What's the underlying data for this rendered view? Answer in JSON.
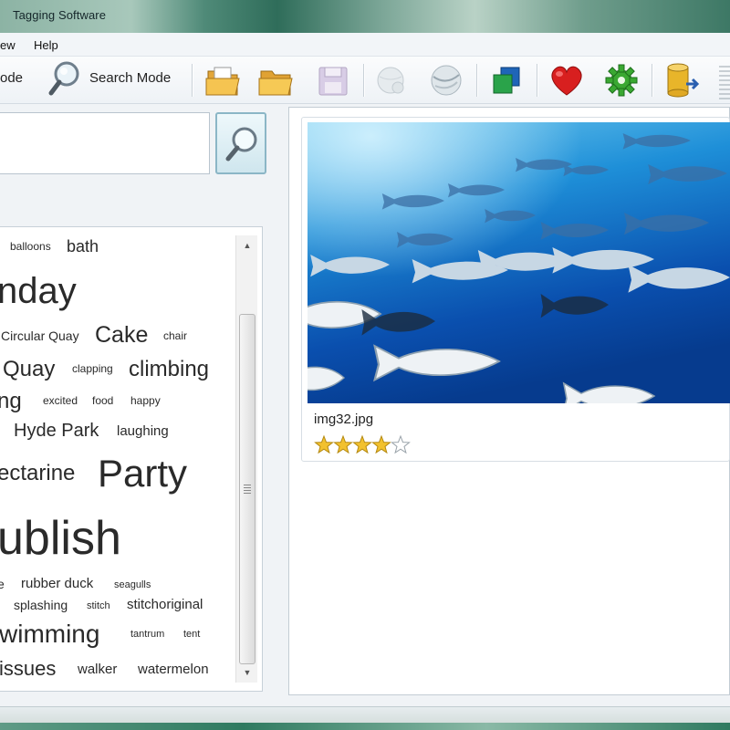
{
  "window": {
    "title": "Tagging Software"
  },
  "menu": {
    "items": [
      "ew",
      "Help"
    ]
  },
  "toolbar": {
    "tag_mode_label": "ode",
    "search_mode_label": "Search Mode"
  },
  "search": {
    "value": ""
  },
  "tag_cloud": {
    "tags": [
      "balloons",
      "bath",
      "nday",
      "Circular Quay",
      "Cake",
      "chair",
      "Quay",
      "clapping",
      "climbing",
      "ng",
      "excited",
      "food",
      "happy",
      "Hyde Park",
      "laughing",
      "ectarine",
      "Party",
      "ublish",
      "e",
      "rubber duck",
      "seagulls",
      "splashing",
      "stitch",
      "stitchoriginal",
      "wimming",
      "tantrum",
      "tent",
      "issues",
      "walker",
      "watermelon"
    ]
  },
  "image": {
    "filename": "img32.jpg",
    "rating": 4,
    "rating_max": 5
  },
  "colors": {
    "star_filled": "#f2c12e",
    "heart": "#d81f1f",
    "gear": "#3aa832"
  }
}
